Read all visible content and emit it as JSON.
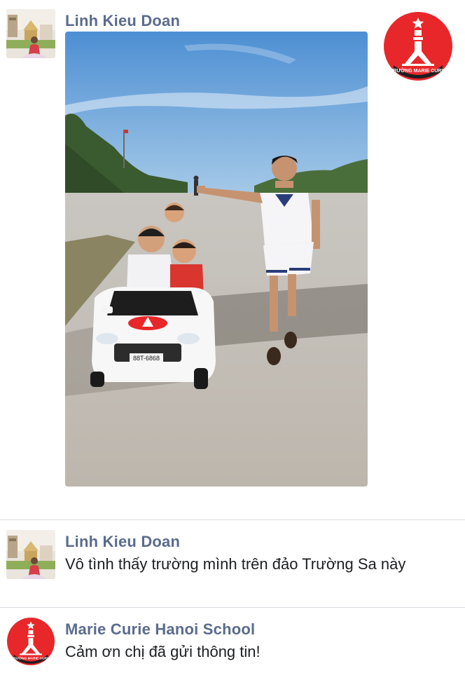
{
  "messages": [
    {
      "sender": "Linh Kieu Doan",
      "avatar_icon": "user-photo-avatar",
      "attachment": {
        "type": "photo",
        "car_plate": "88T-6868"
      }
    },
    {
      "sender": "Linh Kieu Doan",
      "avatar_icon": "user-photo-avatar",
      "text": "Vô tình thấy trường mình trên đảo Trường Sa này"
    },
    {
      "sender": "Marie Curie Hanoi School",
      "avatar_icon": "school-logo",
      "text": "Cảm ơn chị đã gửi thông tin!"
    }
  ],
  "school_logo": {
    "text": "TRƯỜNG MARIE CURIE",
    "color": "#e8272a"
  },
  "colors": {
    "sender_name": "#5b6b8c",
    "divider": "#dadde1",
    "sky": "#5b9ad6",
    "road": "#cfcbc4"
  }
}
